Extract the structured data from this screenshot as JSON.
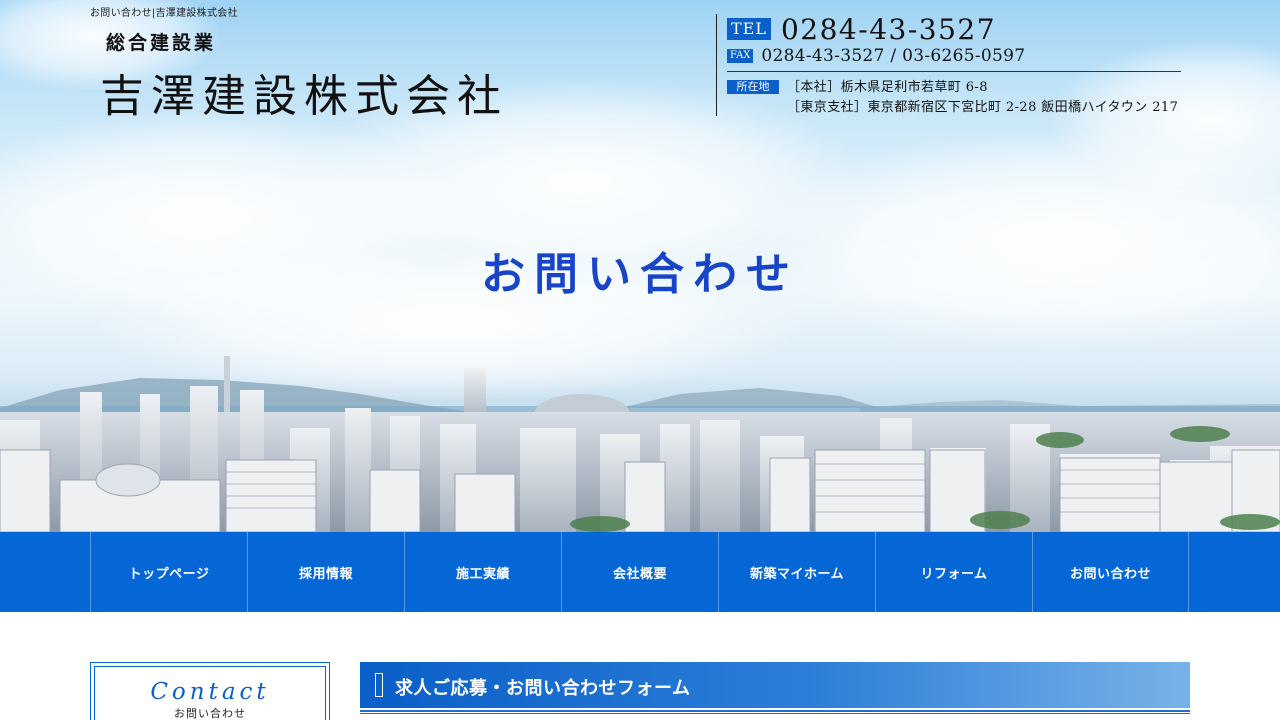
{
  "header": {
    "breadcrumb": "お問い合わせ|吉澤建設株式会社",
    "tagline": "総合建設業",
    "company_name": "吉澤建設株式会社",
    "tel_label": "TEL",
    "tel_number": "0284-43-3527",
    "fax_label": "FAX",
    "fax_number": "0284-43-3527 / 03-6265-0597",
    "address_label": "所在地",
    "address_main": "［本社］栃木県足利市若草町 6-8",
    "address_branch": "［東京支社］東京都新宿区下宮比町 2-28 飯田橋ハイタウン 217"
  },
  "hero": {
    "title": "お問い合わせ"
  },
  "nav": {
    "items": [
      {
        "label": "トップページ"
      },
      {
        "label": "採用情報"
      },
      {
        "label": "施工実績"
      },
      {
        "label": "会社概要"
      },
      {
        "label": "新築マイホーム"
      },
      {
        "label": "リフォーム"
      },
      {
        "label": "お問い合わせ"
      }
    ]
  },
  "sidebar": {
    "title_en": "Contact",
    "title_ja": "お問い合わせ"
  },
  "main": {
    "form_title": "求人ご応募・お問い合わせフォーム"
  },
  "colors": {
    "brand_blue": "#0567d6",
    "heading_blue": "#1845c8"
  }
}
